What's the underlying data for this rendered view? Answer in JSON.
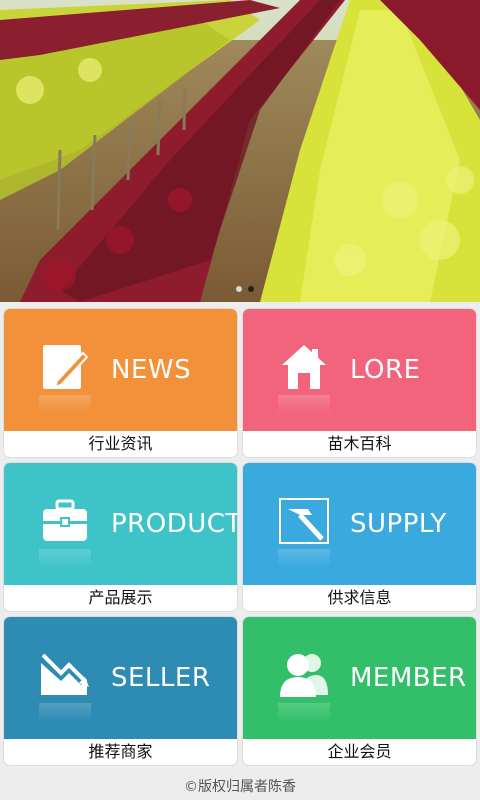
{
  "hero": {
    "image": "plant-nursery-banner",
    "slides": 2,
    "active_slide": 1
  },
  "tiles": [
    {
      "english": "NEWS",
      "label": "行业资讯",
      "color": "#f2913a",
      "icon": "edit-icon"
    },
    {
      "english": "LORE",
      "label": "苗木百科",
      "color": "#f2647c",
      "icon": "home-icon"
    },
    {
      "english": "PRODUCT",
      "label": "产品展示",
      "color": "#3ec3c9",
      "icon": "briefcase-icon"
    },
    {
      "english": "SUPPLY",
      "label": "供求信息",
      "color": "#3aa9de",
      "icon": "hammer-icon"
    },
    {
      "english": "SELLER",
      "label": "推荐商家",
      "color": "#2e8bb4",
      "icon": "trend-down-icon"
    },
    {
      "english": "MEMBER",
      "label": "企业会员",
      "color": "#33bf6a",
      "icon": "users-icon"
    }
  ],
  "footer": {
    "text": "©版权归属者陈香"
  }
}
